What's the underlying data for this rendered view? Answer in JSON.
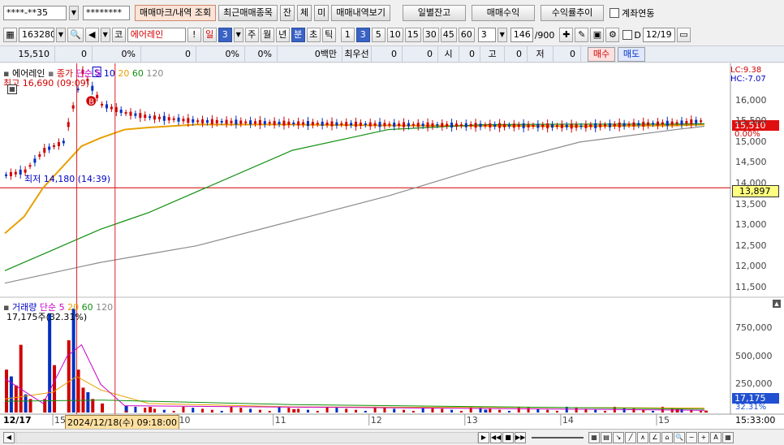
{
  "toolbar": {
    "account": "****-**35",
    "password": "********",
    "buttons": [
      "매매마크/내역 조회",
      "최근매매종목",
      "잔",
      "체",
      "미",
      "매매내역보기"
    ],
    "right_buttons": [
      "일별잔고",
      "매매수익",
      "수익률추이"
    ],
    "checkbox_label": "계좌연동"
  },
  "toolbar2": {
    "code": "163280",
    "market_badge": "코",
    "stock_name": "에어레인",
    "bang": "!",
    "period_buttons": [
      "일",
      "3",
      "주",
      "월",
      "년",
      "분",
      "초",
      "틱"
    ],
    "active_period": "분",
    "interval_buttons": [
      "1",
      "3",
      "5",
      "10",
      "15",
      "30",
      "45",
      "60"
    ],
    "active_interval": "3",
    "combo_value": "3",
    "count": "146",
    "count_total": "/900",
    "d_label": "D",
    "date_value": "12/19"
  },
  "quote_bar": {
    "price": "15,510",
    "change": "0",
    "change_pct": "0%",
    "volume": "0",
    "vol_pct": "0%",
    "other_pct": "0%",
    "amount": "0백만",
    "priority_label": "최우선",
    "bid1": "0",
    "bid2": "0",
    "open_label": "시",
    "open_val": "0",
    "high_label": "고",
    "high_val": "0",
    "low_label": "저",
    "low_val": "0",
    "buy_label": "매수",
    "sell_label": "매도"
  },
  "price_panel": {
    "legend": {
      "name": "에어레인",
      "price_label": "종가",
      "ma_label": "단순",
      "mas": [
        "5",
        "10",
        "20",
        "60",
        "120"
      ]
    },
    "high_note": "최고 16,690 (09:09)",
    "low_note": "최저 14,180 (14:39)",
    "lc": "LC:9.38",
    "hc": "HC:-7.07",
    "current_price_tag": "15,510",
    "current_pct_tag": "0.00%",
    "ref_price_tag": "13,897",
    "y_ticks": [
      "16,000",
      "15,500",
      "15,000",
      "14,500",
      "14,000",
      "13,500",
      "13,000",
      "12,500",
      "12,000",
      "11,500"
    ],
    "marks": {
      "sell": "S",
      "buy": "B"
    }
  },
  "volume_panel": {
    "legend": {
      "name": "거래량",
      "ma_label": "단순",
      "mas": [
        "5",
        "20",
        "60",
        "120"
      ]
    },
    "value_note": "17,175주(32.31%)",
    "y_ticks": [
      "750,000",
      "500,000",
      "250,000"
    ],
    "current_tag": "17,175",
    "current_pct_tag": "32.31%"
  },
  "x_axis": {
    "left_label": "12/17",
    "labels": [
      "15",
      "10",
      "11",
      "12",
      "13",
      "14",
      "15"
    ],
    "crosshair_label": "2024/12/18(수) 09:18:00",
    "time_label": "15:33:00"
  },
  "chart_data": [
    {
      "type": "line",
      "title": "",
      "ylabel": "",
      "ylim": [
        11300,
        16700
      ],
      "series": [
        {
          "name": "종가",
          "x": [
            0,
            4,
            8,
            12,
            16,
            20,
            25,
            30,
            40,
            60,
            80,
            100,
            120,
            140,
            146
          ],
          "values": [
            14200,
            14300,
            14800,
            15000,
            16690,
            15900,
            15700,
            15600,
            15500,
            15450,
            15420,
            15400,
            15380,
            15460,
            15510
          ]
        },
        {
          "name": "20",
          "values": [
            12800,
            13200,
            13900,
            14400,
            14900,
            15100,
            15300,
            15350,
            15420,
            15420,
            15400,
            15390,
            15380,
            15400,
            15420
          ]
        },
        {
          "name": "60",
          "values": [
            11900,
            12100,
            12300,
            12500,
            12700,
            12900,
            13100,
            13300,
            13800,
            14800,
            15300,
            15420,
            15430,
            15430,
            15440
          ]
        },
        {
          "name": "120",
          "values": [
            11600,
            11700,
            11800,
            11900,
            12000,
            12100,
            12200,
            12300,
            12500,
            13100,
            13700,
            14400,
            15000,
            15300,
            15380
          ]
        }
      ]
    },
    {
      "type": "bar",
      "title": "거래량",
      "ylim": [
        0,
        950000
      ],
      "categories": [
        0,
        1,
        2,
        3,
        4,
        5,
        8,
        9,
        10,
        13,
        14,
        15,
        16,
        17,
        18,
        20,
        25,
        30,
        60,
        100,
        140,
        146
      ],
      "values": [
        380000,
        320000,
        240000,
        600000,
        160000,
        120000,
        120000,
        880000,
        420000,
        640000,
        920000,
        380000,
        220000,
        180000,
        120000,
        80000,
        60000,
        50000,
        30000,
        25000,
        30000,
        17175
      ]
    }
  ]
}
